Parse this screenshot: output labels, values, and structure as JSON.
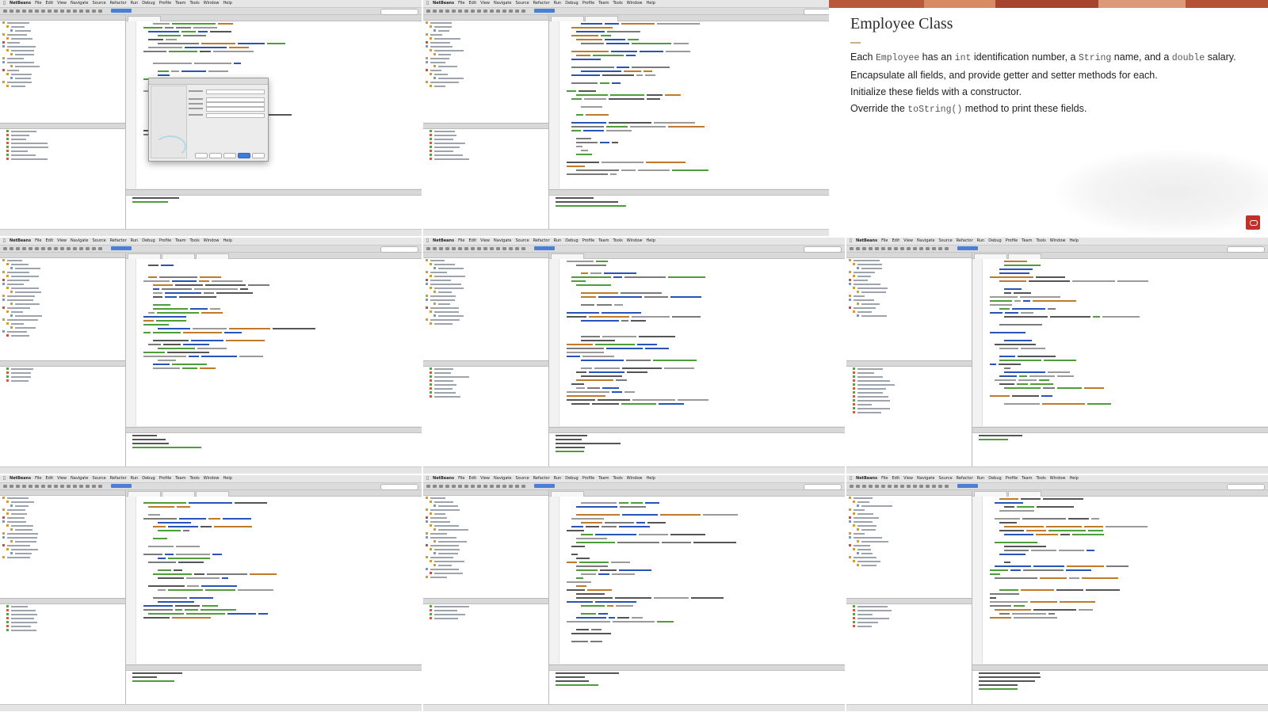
{
  "menubar": {
    "items": [
      "NetBeans",
      "File",
      "Edit",
      "View",
      "Navigate",
      "Source",
      "Refactor",
      "Run",
      "Debug",
      "Profile",
      "Team",
      "Tools",
      "Window",
      "Help"
    ]
  },
  "slide": {
    "title": "Employee Class",
    "paragraph1": {
      "t1": "Each ",
      "c1": "Employee",
      "t2": " has an ",
      "c2": "int",
      "t3": " identification number, a ",
      "c3": "String",
      "t4": " name, and a ",
      "c4": "double",
      "t5": " salary."
    },
    "paragraph2": "Encapsulate all fields, and provide getter and setter methods for each.",
    "paragraph3": "Initialize these fields with a constructor.",
    "paragraph4": {
      "t1": "Override the ",
      "c1": "toString()",
      "t2": " method to print these fields."
    }
  },
  "colors": {
    "ide_background": "#efefef",
    "editor_background": "#ffffff",
    "slide_accent_rule": "#c7b083",
    "logo_red": "#c0312b",
    "code_keyword": "#2a53b8",
    "code_comment": "#9a9a9a",
    "code_string": "#c07a2c",
    "code_green": "#4f9c3a"
  }
}
